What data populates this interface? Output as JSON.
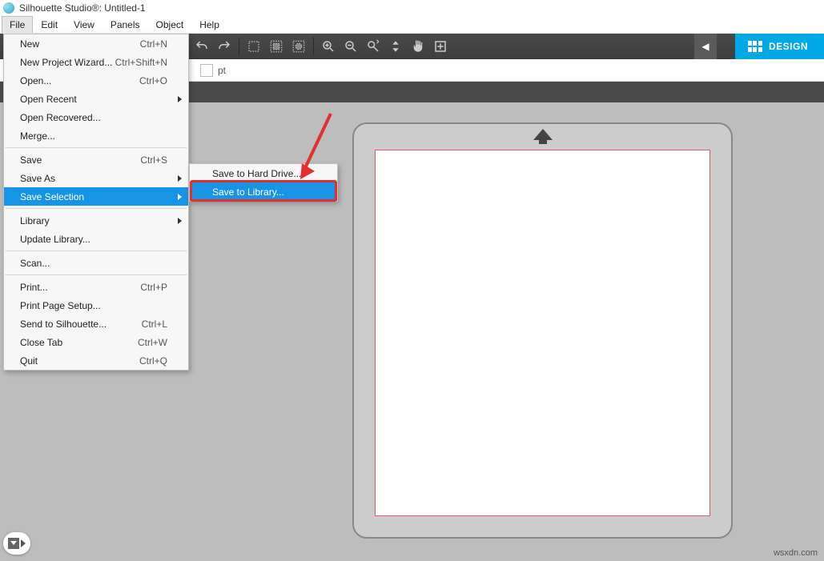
{
  "app": {
    "title": "Silhouette Studio®: Untitled-1"
  },
  "menubar": {
    "file": "File",
    "edit": "Edit",
    "view": "View",
    "panels": "Panels",
    "object": "Object",
    "help": "Help"
  },
  "optbar": {
    "unit": "pt"
  },
  "tabs": {
    "design": "DESIGN"
  },
  "fileMenu": {
    "new": "New",
    "new_sc": "Ctrl+N",
    "wizard": "New Project Wizard...",
    "wizard_sc": "Ctrl+Shift+N",
    "open": "Open...",
    "open_sc": "Ctrl+O",
    "recent": "Open Recent",
    "recovered": "Open Recovered...",
    "merge": "Merge...",
    "save": "Save",
    "save_sc": "Ctrl+S",
    "saveas": "Save As",
    "savesel": "Save Selection",
    "library": "Library",
    "updatelib": "Update Library...",
    "scan": "Scan...",
    "print": "Print...",
    "print_sc": "Ctrl+P",
    "pagesetup": "Print Page Setup...",
    "send": "Send to Silhouette...",
    "send_sc": "Ctrl+L",
    "closetab": "Close Tab",
    "closetab_sc": "Ctrl+W",
    "quit": "Quit",
    "quit_sc": "Ctrl+Q"
  },
  "submenu": {
    "hdd": "Save to Hard Drive...",
    "lib": "Save to Library..."
  },
  "watermark": "wsxdn.com"
}
